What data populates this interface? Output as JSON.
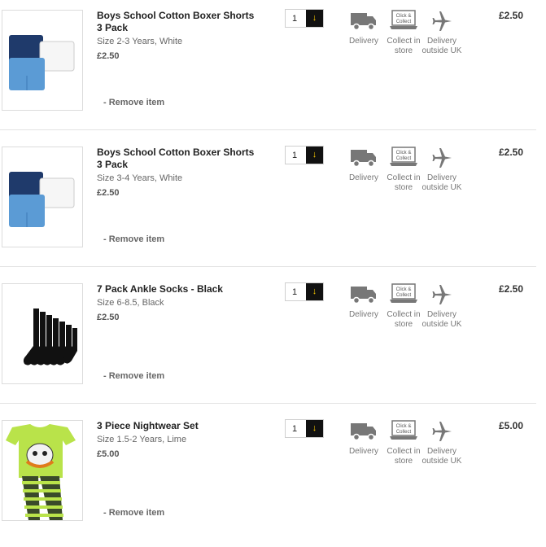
{
  "items": [
    {
      "title": "Boys School Cotton Boxer Shorts 3 Pack",
      "variant": "Size 2-3 Years, White",
      "unit_price": "£2.50",
      "quantity": "1",
      "remove_label": "- Remove item",
      "price": "£2.50",
      "image_icon": "boxer-shorts-image"
    },
    {
      "title": "Boys School Cotton Boxer Shorts 3 Pack",
      "variant": "Size 3-4 Years, White",
      "unit_price": "£2.50",
      "quantity": "1",
      "remove_label": "- Remove item",
      "price": "£2.50",
      "image_icon": "boxer-shorts-image"
    },
    {
      "title": "7 Pack Ankle Socks - Black",
      "variant": "Size 6-8.5, Black",
      "unit_price": "£2.50",
      "quantity": "1",
      "remove_label": "- Remove item",
      "price": "£2.50",
      "image_icon": "socks-image"
    },
    {
      "title": "3 Piece Nightwear Set",
      "variant": "Size 1.5-2 Years, Lime",
      "unit_price": "£5.00",
      "quantity": "1",
      "remove_label": "- Remove item",
      "price": "£5.00",
      "image_icon": "nightwear-image"
    }
  ],
  "options": {
    "delivery": "Delivery",
    "collect_line1": "Collect in",
    "collect_line2": "store",
    "collect_icon_text_1": "Click &",
    "collect_icon_text_2": "Collect",
    "outside_line1": "Delivery",
    "outside_line2": "outside UK"
  },
  "colors": {
    "qty_button_bg": "#111111",
    "qty_arrow": "#f0c000",
    "icon_gray": "#777777"
  }
}
